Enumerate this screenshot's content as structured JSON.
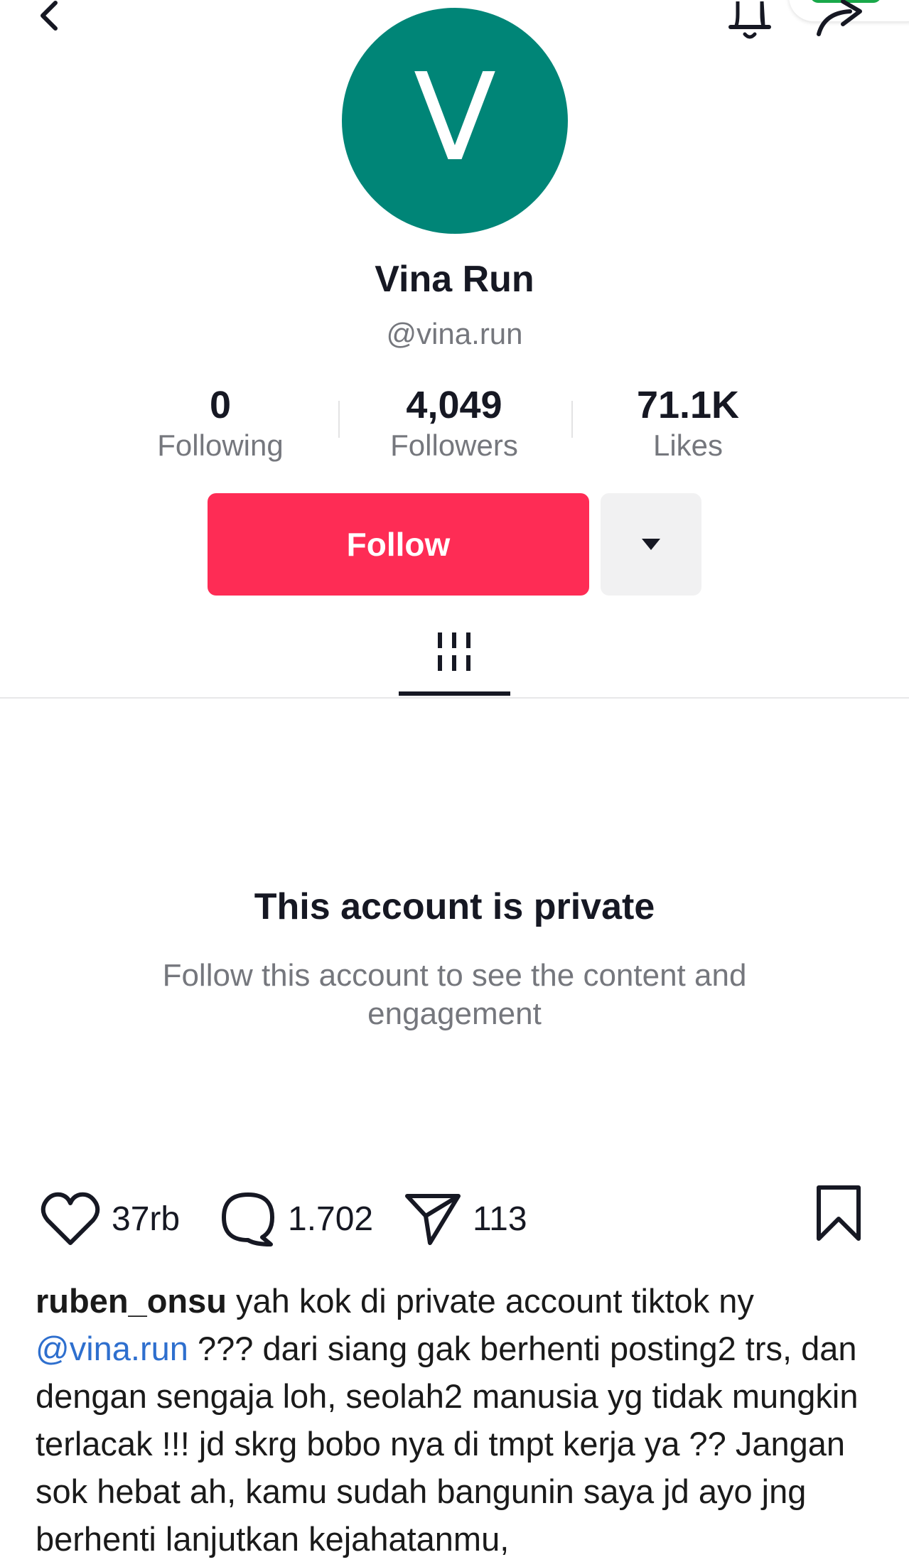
{
  "profile": {
    "avatar_letter": "V",
    "avatar_color": "#008577",
    "display_name": "Vina Run",
    "username": "@vina.run"
  },
  "stats": {
    "following": {
      "value": "0",
      "label": "Following"
    },
    "followers": {
      "value": "4,049",
      "label": "Followers"
    },
    "likes": {
      "value": "71.1K",
      "label": "Likes"
    }
  },
  "actions": {
    "follow_label": "Follow",
    "follow_color": "#fe2c55"
  },
  "private": {
    "title": "This account is private",
    "description": "Follow this account to see the content and engagement"
  },
  "post": {
    "likes": "37rb",
    "comments": "1.702",
    "shares": "113",
    "caption_user": "ruben_onsu",
    "caption_part1": " yah kok di private account tiktok ny ",
    "caption_mention": "@vina.run",
    "caption_part2": " ??? dari siang gak berhenti posting2 trs, dan dengan sengaja loh, seolah2 manusia yg tidak mungkin terlacak !!! jd skrg bobo nya di tmpt kerja ya ?? Jangan sok hebat ah, kamu sudah bangunin saya jd ayo jng berhenti lanjutkan kejahatanmu,"
  },
  "icons": [
    "back-icon",
    "bell-icon",
    "share-icon",
    "dropdown-icon",
    "grid-icon",
    "heart-icon",
    "comment-icon",
    "send-icon",
    "bookmark-icon"
  ]
}
